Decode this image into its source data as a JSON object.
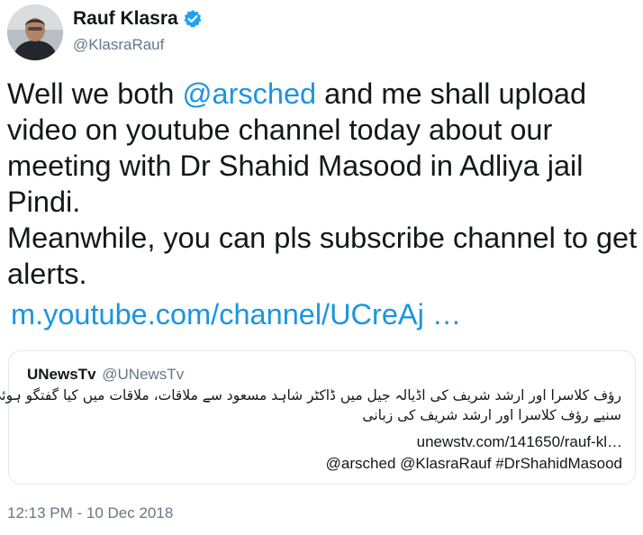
{
  "author": {
    "display_name": "Rauf Klasra",
    "handle": "@KlasraRauf",
    "verified_icon": "verified-badge-icon"
  },
  "tweet": {
    "text_prefix": "Well we both ",
    "mention": "@arsched",
    "text_suffix": " and me shall upload video on youtube channel today about our meeting with Dr Shahid Masood in Adliya jail Pindi.\nMeanwhile, you can pls subscribe channel to get alerts.",
    "link": "m.youtube.com/channel/UCreAj …"
  },
  "quoted_tweet": {
    "display_name": "UNewsTv",
    "handle": "@UNewsTv",
    "urdu_line_1": "رؤف کلاسرا اور ارشد شریف کی اڈیالہ جیل میں ڈاکٹر شاہد مسعود سے ملاقات، ملاقات میں کیا گفتگو ہوئی،",
    "urdu_line_2": "سنیے رؤف کلاسرا اور ارشد شریف کی زبانی",
    "url": "unewstv.com/141650/rauf-kl…",
    "tags": "@arsched @KlasraRauf #DrShahidMasood"
  },
  "timestamp": "12:13 PM - 10 Dec 2018",
  "colors": {
    "link": "#1b95e0",
    "secondary_text": "#657786",
    "border": "#e1e8ed",
    "verified": "#1da1f2"
  }
}
